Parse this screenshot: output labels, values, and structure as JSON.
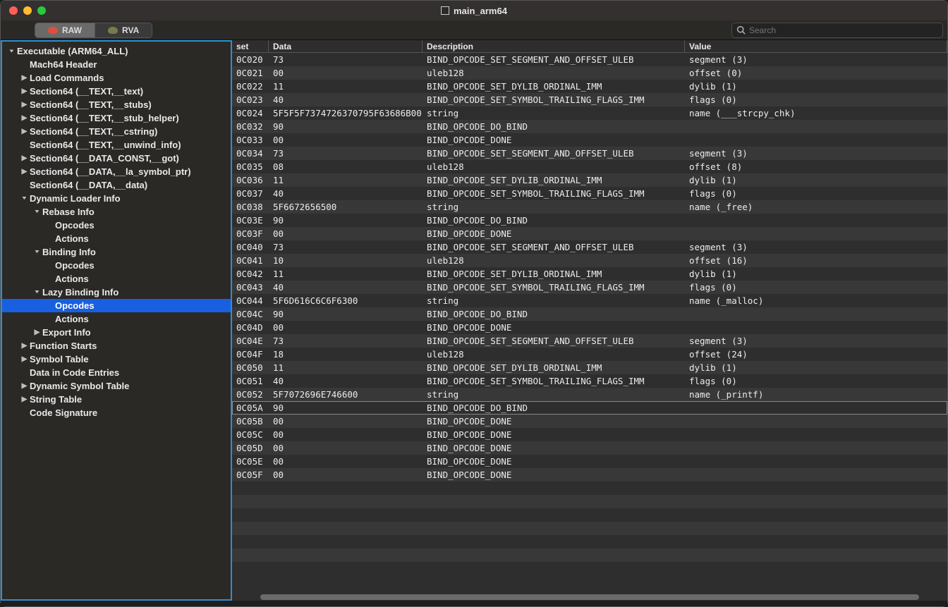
{
  "window": {
    "title": "main_arm64"
  },
  "toolbar": {
    "raw_label": "RAW",
    "rva_label": "RVA",
    "search_placeholder": "Search"
  },
  "tree": [
    {
      "label": "Executable  (ARM64_ALL)",
      "depth": 0,
      "arrow": "down"
    },
    {
      "label": "Mach64 Header",
      "depth": 1,
      "arrow": ""
    },
    {
      "label": "Load Commands",
      "depth": 1,
      "arrow": "right"
    },
    {
      "label": "Section64 (__TEXT,__text)",
      "depth": 1,
      "arrow": "right"
    },
    {
      "label": "Section64 (__TEXT,__stubs)",
      "depth": 1,
      "arrow": "right"
    },
    {
      "label": "Section64 (__TEXT,__stub_helper)",
      "depth": 1,
      "arrow": "right"
    },
    {
      "label": "Section64 (__TEXT,__cstring)",
      "depth": 1,
      "arrow": "right"
    },
    {
      "label": "Section64 (__TEXT,__unwind_info)",
      "depth": 1,
      "arrow": ""
    },
    {
      "label": "Section64 (__DATA_CONST,__got)",
      "depth": 1,
      "arrow": "right"
    },
    {
      "label": "Section64 (__DATA,__la_symbol_ptr)",
      "depth": 1,
      "arrow": "right"
    },
    {
      "label": "Section64 (__DATA,__data)",
      "depth": 1,
      "arrow": ""
    },
    {
      "label": "Dynamic Loader Info",
      "depth": 1,
      "arrow": "down"
    },
    {
      "label": "Rebase Info",
      "depth": 2,
      "arrow": "down"
    },
    {
      "label": "Opcodes",
      "depth": 3,
      "arrow": ""
    },
    {
      "label": "Actions",
      "depth": 3,
      "arrow": ""
    },
    {
      "label": "Binding Info",
      "depth": 2,
      "arrow": "down"
    },
    {
      "label": "Opcodes",
      "depth": 3,
      "arrow": ""
    },
    {
      "label": "Actions",
      "depth": 3,
      "arrow": ""
    },
    {
      "label": "Lazy Binding Info",
      "depth": 2,
      "arrow": "down"
    },
    {
      "label": "Opcodes",
      "depth": 3,
      "arrow": "",
      "selected": true
    },
    {
      "label": "Actions",
      "depth": 3,
      "arrow": ""
    },
    {
      "label": "Export Info",
      "depth": 2,
      "arrow": "right"
    },
    {
      "label": "Function Starts",
      "depth": 1,
      "arrow": "right"
    },
    {
      "label": "Symbol Table",
      "depth": 1,
      "arrow": "right"
    },
    {
      "label": "Data in Code Entries",
      "depth": 1,
      "arrow": ""
    },
    {
      "label": "Dynamic Symbol Table",
      "depth": 1,
      "arrow": "right"
    },
    {
      "label": "String Table",
      "depth": 1,
      "arrow": "right"
    },
    {
      "label": "Code Signature",
      "depth": 1,
      "arrow": ""
    }
  ],
  "columns": {
    "offset": "set",
    "data": "Data",
    "desc": "Description",
    "value": "Value"
  },
  "rows": [
    {
      "offset": "0C020",
      "data": "73",
      "desc": "BIND_OPCODE_SET_SEGMENT_AND_OFFSET_ULEB",
      "value": "segment (3)"
    },
    {
      "offset": "0C021",
      "data": "00",
      "desc": "uleb128",
      "value": "offset (0)"
    },
    {
      "offset": "0C022",
      "data": "11",
      "desc": "BIND_OPCODE_SET_DYLIB_ORDINAL_IMM",
      "value": "dylib (1)"
    },
    {
      "offset": "0C023",
      "data": "40",
      "desc": "BIND_OPCODE_SET_SYMBOL_TRAILING_FLAGS_IMM",
      "value": "flags (0)"
    },
    {
      "offset": "0C024",
      "data": "5F5F5F7374726370795F63686B00",
      "desc": "string",
      "value": "name (___strcpy_chk)"
    },
    {
      "offset": "0C032",
      "data": "90",
      "desc": "BIND_OPCODE_DO_BIND",
      "value": ""
    },
    {
      "offset": "0C033",
      "data": "00",
      "desc": "BIND_OPCODE_DONE",
      "value": ""
    },
    {
      "offset": "0C034",
      "data": "73",
      "desc": "BIND_OPCODE_SET_SEGMENT_AND_OFFSET_ULEB",
      "value": "segment (3)"
    },
    {
      "offset": "0C035",
      "data": "08",
      "desc": "uleb128",
      "value": "offset (8)"
    },
    {
      "offset": "0C036",
      "data": "11",
      "desc": "BIND_OPCODE_SET_DYLIB_ORDINAL_IMM",
      "value": "dylib (1)"
    },
    {
      "offset": "0C037",
      "data": "40",
      "desc": "BIND_OPCODE_SET_SYMBOL_TRAILING_FLAGS_IMM",
      "value": "flags (0)"
    },
    {
      "offset": "0C038",
      "data": "5F6672656500",
      "desc": "string",
      "value": "name (_free)"
    },
    {
      "offset": "0C03E",
      "data": "90",
      "desc": "BIND_OPCODE_DO_BIND",
      "value": ""
    },
    {
      "offset": "0C03F",
      "data": "00",
      "desc": "BIND_OPCODE_DONE",
      "value": ""
    },
    {
      "offset": "0C040",
      "data": "73",
      "desc": "BIND_OPCODE_SET_SEGMENT_AND_OFFSET_ULEB",
      "value": "segment (3)"
    },
    {
      "offset": "0C041",
      "data": "10",
      "desc": "uleb128",
      "value": "offset (16)"
    },
    {
      "offset": "0C042",
      "data": "11",
      "desc": "BIND_OPCODE_SET_DYLIB_ORDINAL_IMM",
      "value": "dylib (1)"
    },
    {
      "offset": "0C043",
      "data": "40",
      "desc": "BIND_OPCODE_SET_SYMBOL_TRAILING_FLAGS_IMM",
      "value": "flags (0)"
    },
    {
      "offset": "0C044",
      "data": "5F6D616C6C6F6300",
      "desc": "string",
      "value": "name (_malloc)"
    },
    {
      "offset": "0C04C",
      "data": "90",
      "desc": "BIND_OPCODE_DO_BIND",
      "value": ""
    },
    {
      "offset": "0C04D",
      "data": "00",
      "desc": "BIND_OPCODE_DONE",
      "value": ""
    },
    {
      "offset": "0C04E",
      "data": "73",
      "desc": "BIND_OPCODE_SET_SEGMENT_AND_OFFSET_ULEB",
      "value": "segment (3)"
    },
    {
      "offset": "0C04F",
      "data": "18",
      "desc": "uleb128",
      "value": "offset (24)"
    },
    {
      "offset": "0C050",
      "data": "11",
      "desc": "BIND_OPCODE_SET_DYLIB_ORDINAL_IMM",
      "value": "dylib (1)"
    },
    {
      "offset": "0C051",
      "data": "40",
      "desc": "BIND_OPCODE_SET_SYMBOL_TRAILING_FLAGS_IMM",
      "value": "flags (0)"
    },
    {
      "offset": "0C052",
      "data": "5F7072696E746600",
      "desc": "string",
      "value": "name (_printf)"
    },
    {
      "offset": "0C05A",
      "data": "90",
      "desc": "BIND_OPCODE_DO_BIND",
      "value": ""
    },
    {
      "offset": "0C05B",
      "data": "00",
      "desc": "BIND_OPCODE_DONE",
      "value": ""
    },
    {
      "offset": "0C05C",
      "data": "00",
      "desc": "BIND_OPCODE_DONE",
      "value": ""
    },
    {
      "offset": "0C05D",
      "data": "00",
      "desc": "BIND_OPCODE_DONE",
      "value": ""
    },
    {
      "offset": "0C05E",
      "data": "00",
      "desc": "BIND_OPCODE_DONE",
      "value": ""
    },
    {
      "offset": "0C05F",
      "data": "00",
      "desc": "BIND_OPCODE_DONE",
      "value": ""
    }
  ],
  "selected_row_index": 26
}
